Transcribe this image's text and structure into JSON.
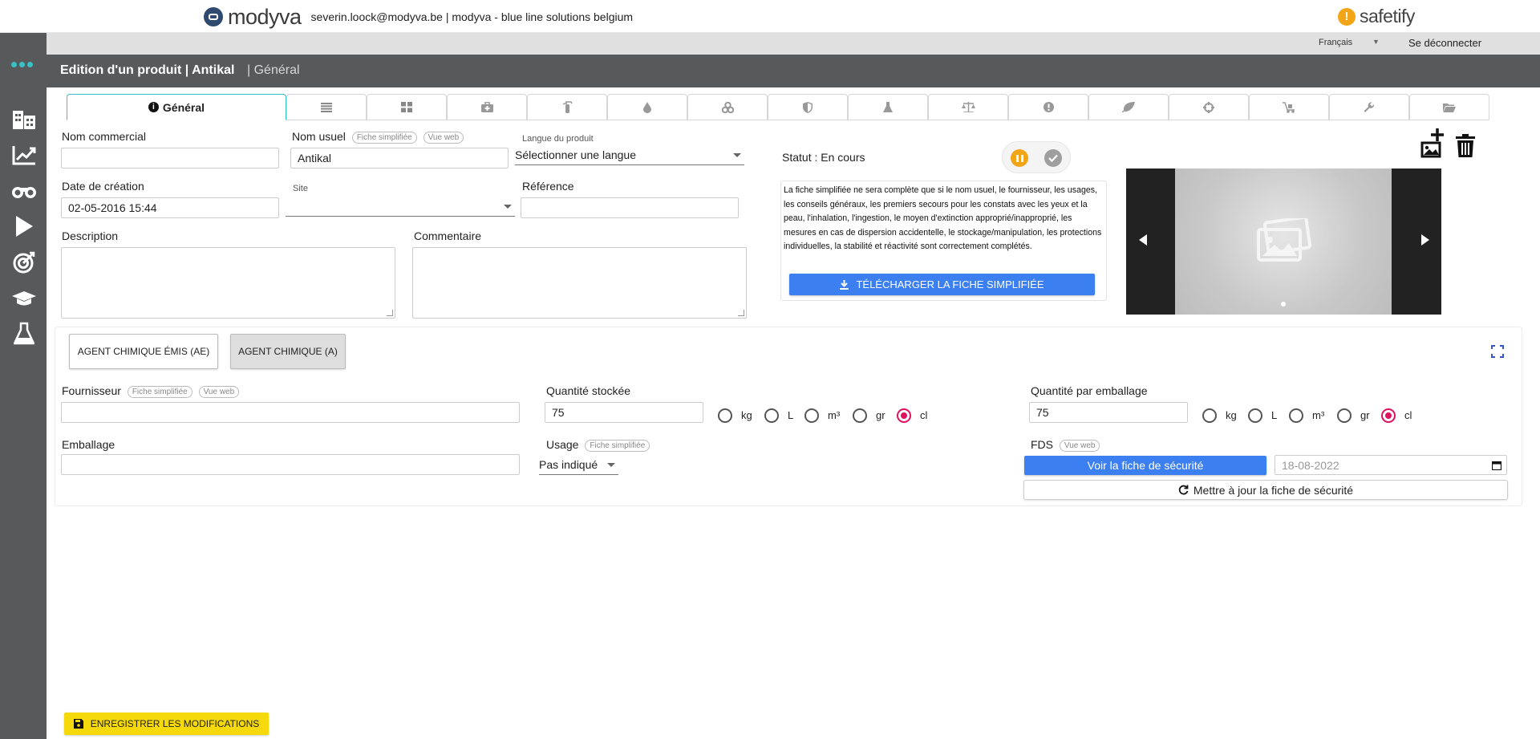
{
  "header": {
    "brand_name": "modyva",
    "user_info": "severin.loock@modyva.be | modyva - blue line solutions belgium",
    "partner_name": "safetify",
    "partner_logo_glyph": "!"
  },
  "topnav": {
    "language": "Français",
    "logout": "Se déconnecter"
  },
  "sidebar": {
    "items": [
      "dots-icon",
      "buildings-icon",
      "chart-icon",
      "binoculars-icon",
      "play-icon",
      "target-icon",
      "graduation-cap-icon",
      "flask-icon"
    ]
  },
  "titlebar": {
    "title": "Edition d'un produit | Antikal",
    "subtitle": "| Général"
  },
  "tabs": {
    "active_label": "Général",
    "icons": [
      "list-icon",
      "grid-icon",
      "first-aid-kit-icon",
      "fire-extinguisher-icon",
      "drop-icon",
      "biohazard-icon",
      "shield-icon",
      "flask-icon",
      "scale-icon",
      "exclamation-icon",
      "leaf-icon",
      "crosshair-icon",
      "hand-cart-icon",
      "wrench-icon",
      "folder-icon"
    ]
  },
  "form": {
    "nom_commercial_label": "Nom commercial",
    "nom_commercial_value": "",
    "nom_usuel_label": "Nom usuel",
    "nom_usuel_value": "Antikal",
    "pill_fiche": "Fiche simplifiée",
    "pill_web": "Vue web",
    "langue_label": "Langue du produit",
    "langue_value": "Sélectionner une langue",
    "date_label": "Date de création",
    "date_value": "02-05-2016 15:44",
    "site_label": "Site",
    "site_value": "",
    "reference_label": "Référence",
    "reference_value": "",
    "description_label": "Description",
    "commentaire_label": "Commentaire"
  },
  "status": {
    "label": "Statut : En cours",
    "text": "La fiche simplifiée ne sera complète que si le nom usuel, le fournisseur, les usages, les conseils généraux, les premiers secours pour les constats avec les yeux et la peau, l'inhalation, l'ingestion, le moyen d'extinction approprié/inapproprié, les mesures en cas de dispersion accidentelle, le stockage/manipulation, les protections individuelles, la stabilité et réactivité sont correctement complétés.",
    "download_button": "TÉLÉCHARGER LA FICHE SIMPLIFIÉE"
  },
  "agents": {
    "ae_label": "AGENT CHIMIQUE ÉMIS (AE)",
    "a_label": "AGENT CHIMIQUE (A)"
  },
  "lower": {
    "fournisseur_label": "Fournisseur",
    "fournisseur_value": "",
    "quantite_label": "Quantité stockée",
    "quantite_value": "75",
    "quantite_emb_label": "Quantité par emballage",
    "quantite_emb_value": "75",
    "units": [
      "kg",
      "L",
      "m³",
      "gr",
      "cl"
    ],
    "selected_unit": "cl",
    "emballage_label": "Emballage",
    "emballage_value": "",
    "usage_label": "Usage",
    "usage_value": "Pas indiqué",
    "fds_label": "FDS",
    "voir_fds_button": "Voir la fiche de sécurité",
    "fds_date": "18-08-2022",
    "update_fds_button": "Mettre à jour la fiche de sécurité"
  },
  "footer": {
    "save_button": "ENREGISTRER LES MODIFICATIONS"
  },
  "colors": {
    "sidebar": "#58595b",
    "accent_teal": "#39c0c4",
    "primary_blue": "#3b7ff0",
    "save_yellow": "#f5d90a",
    "status_orange": "#f2a516",
    "radio_pink": "#e0115f"
  }
}
